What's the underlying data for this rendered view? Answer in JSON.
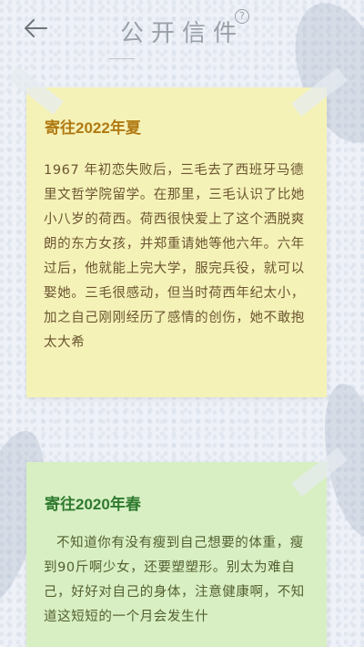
{
  "header": {
    "title": "公开信件",
    "help_glyph": "?"
  },
  "letters": [
    {
      "title": "寄往2022年夏",
      "body": "1967 年初恋失败后，三毛去了西班牙马德里文哲学院留学。在那里，三毛认识了比她小八岁的荷西。荷西很快爱上了这个洒脱爽朗的东方女孩，并郑重请她等他六年。六年过后，他就能上完大学，服完兵役，就可以娶她。三毛很感动，但当时荷西年纪太小，加之自己刚刚经历了感情的创伤，她不敢抱太大希",
      "bg_color": "#f5f2b8",
      "title_color": "#b07a12"
    },
    {
      "title": "寄往2020年春",
      "body": "不知道你有没有瘦到自己想要的体重，瘦到90斤啊少女，还要塑塑形。别太为难自己，好好对自己的身体，注意健康啊，不知道这短短的一个月会发生什",
      "bg_color": "#d8efc4",
      "title_color": "#2f7a2f"
    }
  ]
}
